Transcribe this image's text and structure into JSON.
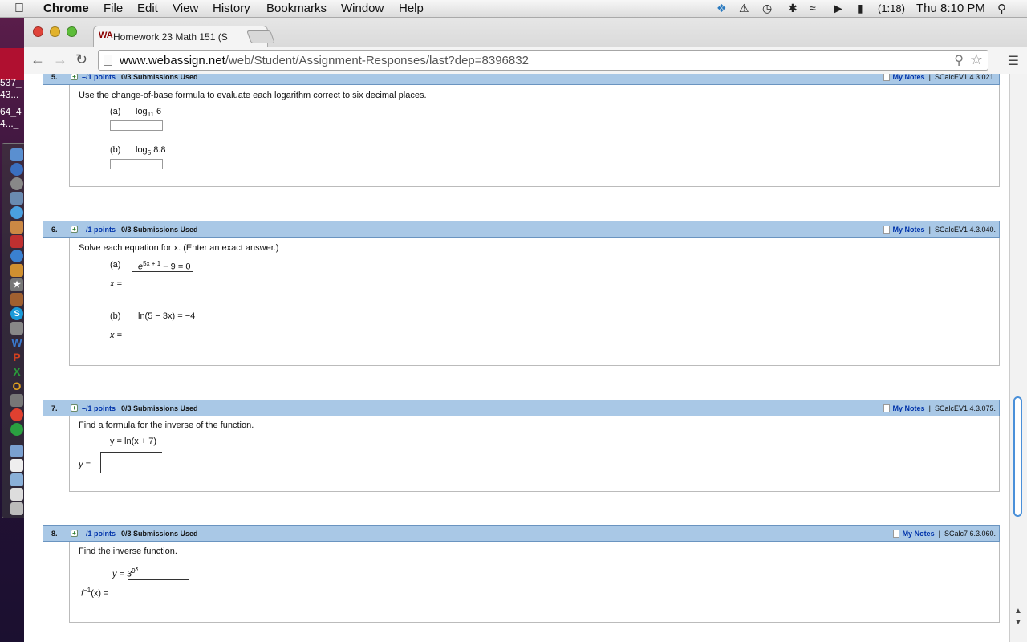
{
  "menubar": {
    "app": "Chrome",
    "items": [
      "File",
      "Edit",
      "View",
      "History",
      "Bookmarks",
      "Window",
      "Help"
    ],
    "battery": "(1:18)",
    "clock": "Thu 8:10 PM"
  },
  "desktop": {
    "thumb1": "537_",
    "thumb2": "43...",
    "thumb3": "64_4",
    "thumb4": "4..._"
  },
  "browser": {
    "tab_title": "Homework 23 Math 151 (S",
    "tab_favicon": "WA",
    "url_host": "www.webassign.net",
    "url_path": "/web/Student/Assignment-Responses/last?dep=8396832"
  },
  "questions": [
    {
      "num": "5.",
      "points": "–/1 points",
      "submissions": "0/3 Submissions Used",
      "notes": "My Notes",
      "sep": "|",
      "source": "SCalcEV1 4.3.021.",
      "text": "Use the change-of-base formula to evaluate each logarithm correct to six decimal places.",
      "parts": [
        {
          "label": "(a)",
          "expr_base": "log",
          "expr_sub": "11",
          "expr_tail": " 6"
        },
        {
          "label": "(b)",
          "expr_base": "log",
          "expr_sub": "5",
          "expr_tail": " 8.8"
        }
      ]
    },
    {
      "num": "6.",
      "points": "–/1 points",
      "submissions": "0/3 Submissions Used",
      "notes": "My Notes",
      "sep": "|",
      "source": "SCalcEV1 4.3.040.",
      "text": "Solve each equation for x. (Enter an exact answer.)",
      "parts": [
        {
          "label": "(a)",
          "expr_base": "e",
          "expr_sup": "5x + 1",
          "expr_tail": " − 9 = 0",
          "answer_label": "x ="
        },
        {
          "label": "(b)",
          "expr": "ln(5 − 3x) = −4",
          "answer_label": "x ="
        }
      ]
    },
    {
      "num": "7.",
      "points": "–/1 points",
      "submissions": "0/3 Submissions Used",
      "notes": "My Notes",
      "sep": "|",
      "source": "SCalcEV1 4.3.075.",
      "text": "Find a formula for the inverse of the function.",
      "expr": "y = ln(x + 7)",
      "answer_label": "y ="
    },
    {
      "num": "8.",
      "points": "–/1 points",
      "submissions": "0/3 Submissions Used",
      "notes": "My Notes",
      "sep": "|",
      "source": "SCalc7 6.3.060.",
      "text": "Find the inverse function.",
      "expr_base": "y = 3",
      "expr_sup": "9",
      "expr_supsup": "x",
      "answer_f": "f",
      "answer_sup": "−1",
      "answer_tail": "(x)  ="
    }
  ],
  "colors": {
    "header_blue": "#a9c8e6",
    "link_blue": "#0033aa"
  }
}
